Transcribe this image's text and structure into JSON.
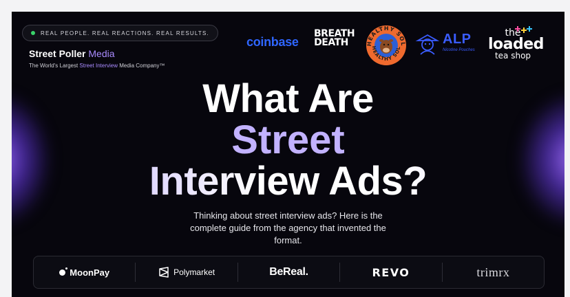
{
  "tagline": "REAL PEOPLE. REAL REACTIONS. REAL RESULTS.",
  "brand": {
    "name_part1": "Street Poller ",
    "name_part2": "Media",
    "sub_part1": "The World's Largest ",
    "sub_part2": "Street Interview",
    "sub_part3": " Media Company™"
  },
  "top_logos": {
    "coinbase": "coinbase",
    "breath_death_line1": "BREATH",
    "breath_death_line2": "DEATH",
    "healthy_sol": "HEALTHY SOL",
    "alp": "ALP",
    "alp_sub": "Nicotine Pouches",
    "loaded_1": "the",
    "loaded_2": "loaded",
    "loaded_3": "tea shop"
  },
  "headline": {
    "line1": "What Are",
    "line2": "Street",
    "line3": "Interview Ads?"
  },
  "subtitle": "Thinking about street interview ads? Here is the complete guide from the agency that invented the format.",
  "bottom_logos": {
    "moonpay": "MoonPay",
    "polymarket": "Polymarket",
    "bereal": "BeReal.",
    "revo": "REVO",
    "trimrx": "trimrx"
  },
  "colors": {
    "accent_purple": "#a98bff",
    "coinbase_blue": "#2f66ff",
    "alp_blue": "#3a5cff",
    "green_dot": "#39d46a",
    "background": "#07060d"
  }
}
